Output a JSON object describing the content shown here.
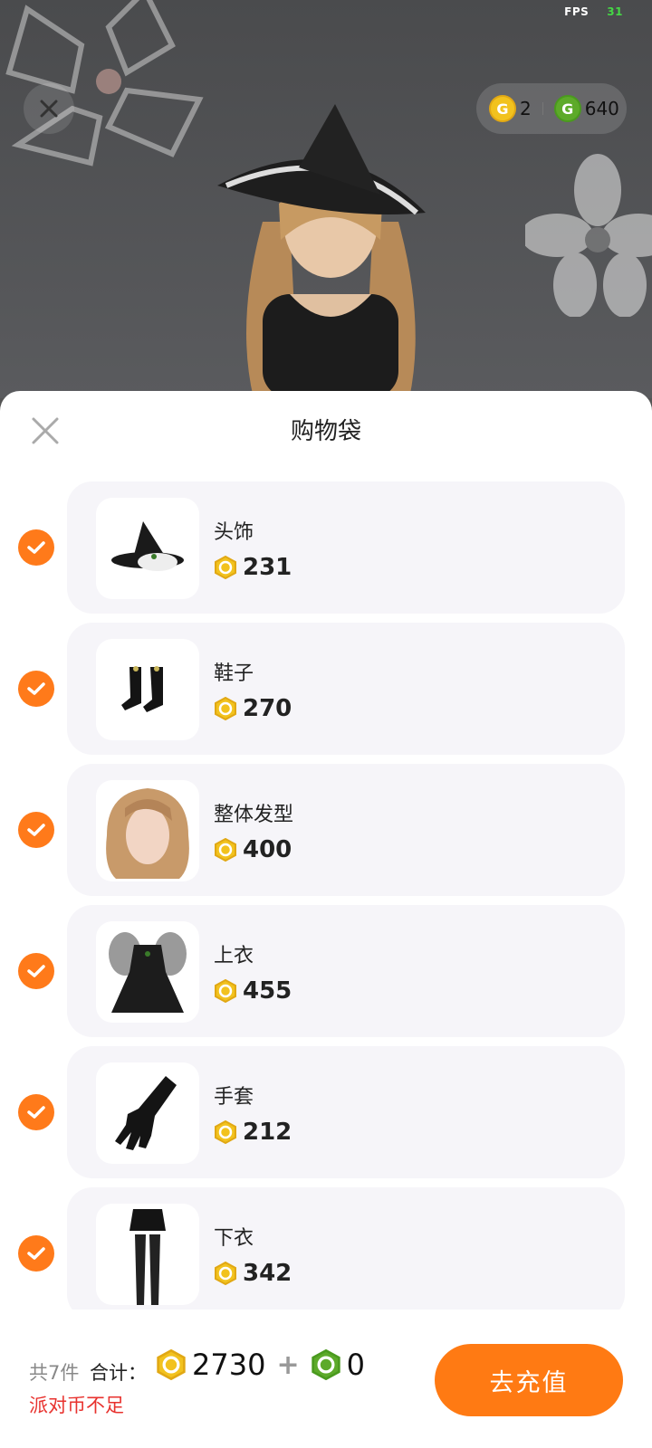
{
  "fps": {
    "label": "FPS",
    "value": "31"
  },
  "currency": {
    "gold": "2",
    "green": "640"
  },
  "sheet": {
    "title": "购物袋"
  },
  "items": [
    {
      "name": "头饰",
      "price": "231",
      "icon": "witch-hat-icon"
    },
    {
      "name": "鞋子",
      "price": "270",
      "icon": "boots-icon"
    },
    {
      "name": "整体发型",
      "price": "400",
      "icon": "hairstyle-icon"
    },
    {
      "name": "上衣",
      "price": "455",
      "icon": "top-dress-icon"
    },
    {
      "name": "手套",
      "price": "212",
      "icon": "glove-icon"
    },
    {
      "name": "下衣",
      "price": "342",
      "icon": "bottoms-icon"
    }
  ],
  "footer": {
    "count": "共7件",
    "total_label": "合计：",
    "total_gold": "2730",
    "plus": "+",
    "total_green": "0",
    "warning": "派对币不足",
    "button": "去充值"
  },
  "colors": {
    "accent": "#ff7a13",
    "warning": "#e8322e",
    "gold_coin": "#f2c21e",
    "green_coin": "#5daa2a"
  }
}
